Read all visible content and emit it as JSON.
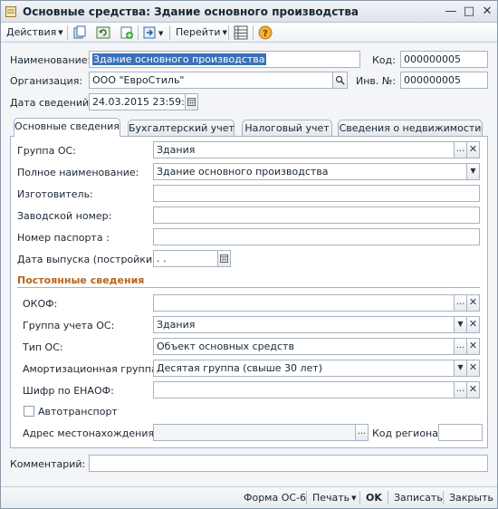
{
  "window": {
    "title": "Основные средства: Здание основного производства"
  },
  "toolbar": {
    "actions_label": "Действия",
    "goto_label": "Перейти",
    "icons": [
      "copy-icon",
      "refresh-icon",
      "new-icon",
      "arrow-menu-icon",
      "structure-icon",
      "help-icon"
    ]
  },
  "header": {
    "name_label": "Наименование:",
    "name_value": "Здание основного производства",
    "code_label": "Код:",
    "code_value": "000000005",
    "org_label": "Организация:",
    "org_value": "ООО \"ЕвроСтиль\"",
    "inv_label": "Инв. №:",
    "inv_value": "000000005",
    "date_label": "Дата сведений:",
    "date_value": "24.03.2015 23:59:59"
  },
  "tabs": [
    {
      "label": "Основные сведения",
      "active": true
    },
    {
      "label": "Бухгалтерский учет",
      "active": false
    },
    {
      "label": "Налоговый учет",
      "active": false
    },
    {
      "label": "Сведения о недвижимости",
      "active": false
    }
  ],
  "main": {
    "group_label": "Группа ОС:",
    "group_value": "Здания",
    "fullname_label": "Полное наименование:",
    "fullname_value": "Здание основного производства",
    "manufacturer_label": "Изготовитель:",
    "manufacturer_value": "",
    "serial_label": "Заводской номер:",
    "serial_value": "",
    "passport_label": "Номер паспорта :",
    "passport_value": "",
    "release_label": "Дата выпуска (постройки):",
    "release_value": " .  .",
    "permanent_title": "Постоянные сведения",
    "okof_label": "ОКОФ:",
    "okof_value": "",
    "accgroup_label": "Группа учета ОС:",
    "accgroup_value": "Здания",
    "type_label": "Тип ОС:",
    "type_value": "Объект основных средств",
    "amort_label": "Амортизационная группа:",
    "amort_value": "Десятая группа (свыше 30 лет)",
    "enaof_label": "Шифр по ЕНАОФ:",
    "enaof_value": "",
    "vehicle_label": "Автотранспорт",
    "address_label": "Адрес местонахождения:",
    "address_value": "",
    "region_label": "Код региона:",
    "region_value": ""
  },
  "comment": {
    "label": "Комментарий:",
    "value": ""
  },
  "footer": {
    "form_label": "Форма ОС-6",
    "print_label": "Печать",
    "ok_label": "OK",
    "save_label": "Записать",
    "close_label": "Закрыть"
  }
}
